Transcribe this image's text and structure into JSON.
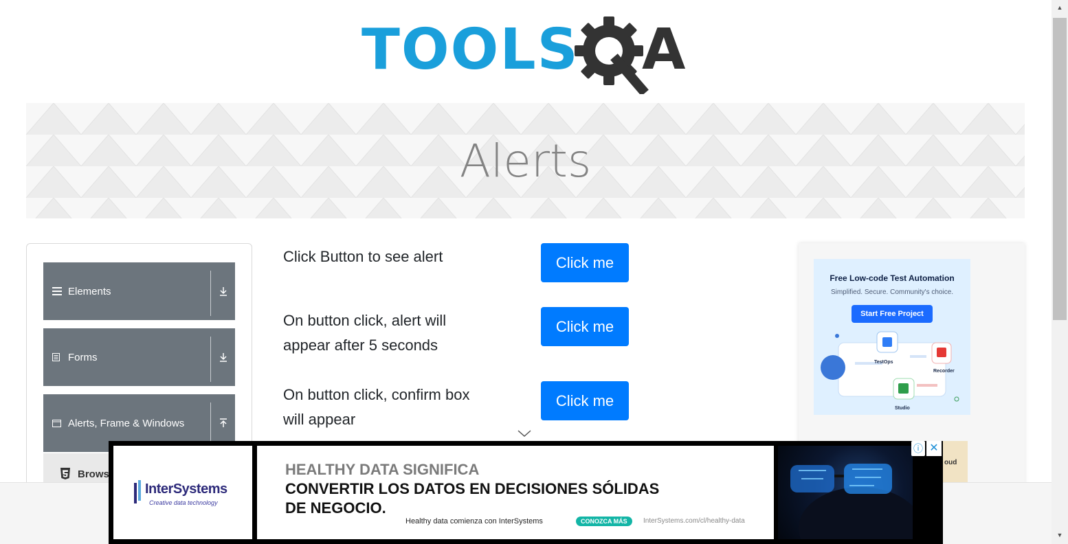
{
  "logo": {
    "text": "TOOLS",
    "suffix": "A",
    "brand_blue": "#1a9fdb",
    "brand_dark": "#333333"
  },
  "banner": {
    "title": "Alerts"
  },
  "sidebar": {
    "groups": [
      {
        "label": "Elements",
        "icon": "menu-icon",
        "arrow": "download-arrow-icon"
      },
      {
        "label": "Forms",
        "icon": "document-icon",
        "arrow": "download-arrow-icon"
      },
      {
        "label": "Alerts, Frame & Windows",
        "icon": "window-icon",
        "arrow": "upload-arrow-icon"
      }
    ],
    "sub_item": {
      "label": "Brows",
      "icon": "html5-icon"
    }
  },
  "main": {
    "rows": [
      {
        "text": "Click Button to see alert",
        "button": "Click me"
      },
      {
        "text_line1": "On button click, alert will",
        "text_line2": "appear after 5 seconds",
        "button": "Click me"
      },
      {
        "text_line1": "On button click, confirm box",
        "text_line2": "will appear",
        "button": "Click me"
      }
    ]
  },
  "right_ad": {
    "title": "Free Low-code Test Automation",
    "subtitle": "Simplified. Secure. Community's choice.",
    "button": "Start Free Project",
    "labels": {
      "testops": "TestOps",
      "recorder": "Recorder",
      "studio": "Studio"
    },
    "partial_label": "oud"
  },
  "bottom_ad": {
    "brand": "InterSystems",
    "tagline": "Creative data technology",
    "line1": "HEALTHY DATA SIGNIFICA",
    "line2": "CONVERTIR LOS DATOS EN DECISIONES SÓLIDAS",
    "line3": "DE NEGOCIO.",
    "footer": "Healthy data comienza con InterSystems",
    "cta": "CONOZCA MÁS",
    "url": "InterSystems.com/cl/healthy-data",
    "info": "ⓘ",
    "close": "✕"
  },
  "scrollbar": {
    "up": "▲",
    "down": "▼"
  },
  "colors": {
    "primary_button": "#007bff",
    "sidebar_group": "#6c757d"
  }
}
